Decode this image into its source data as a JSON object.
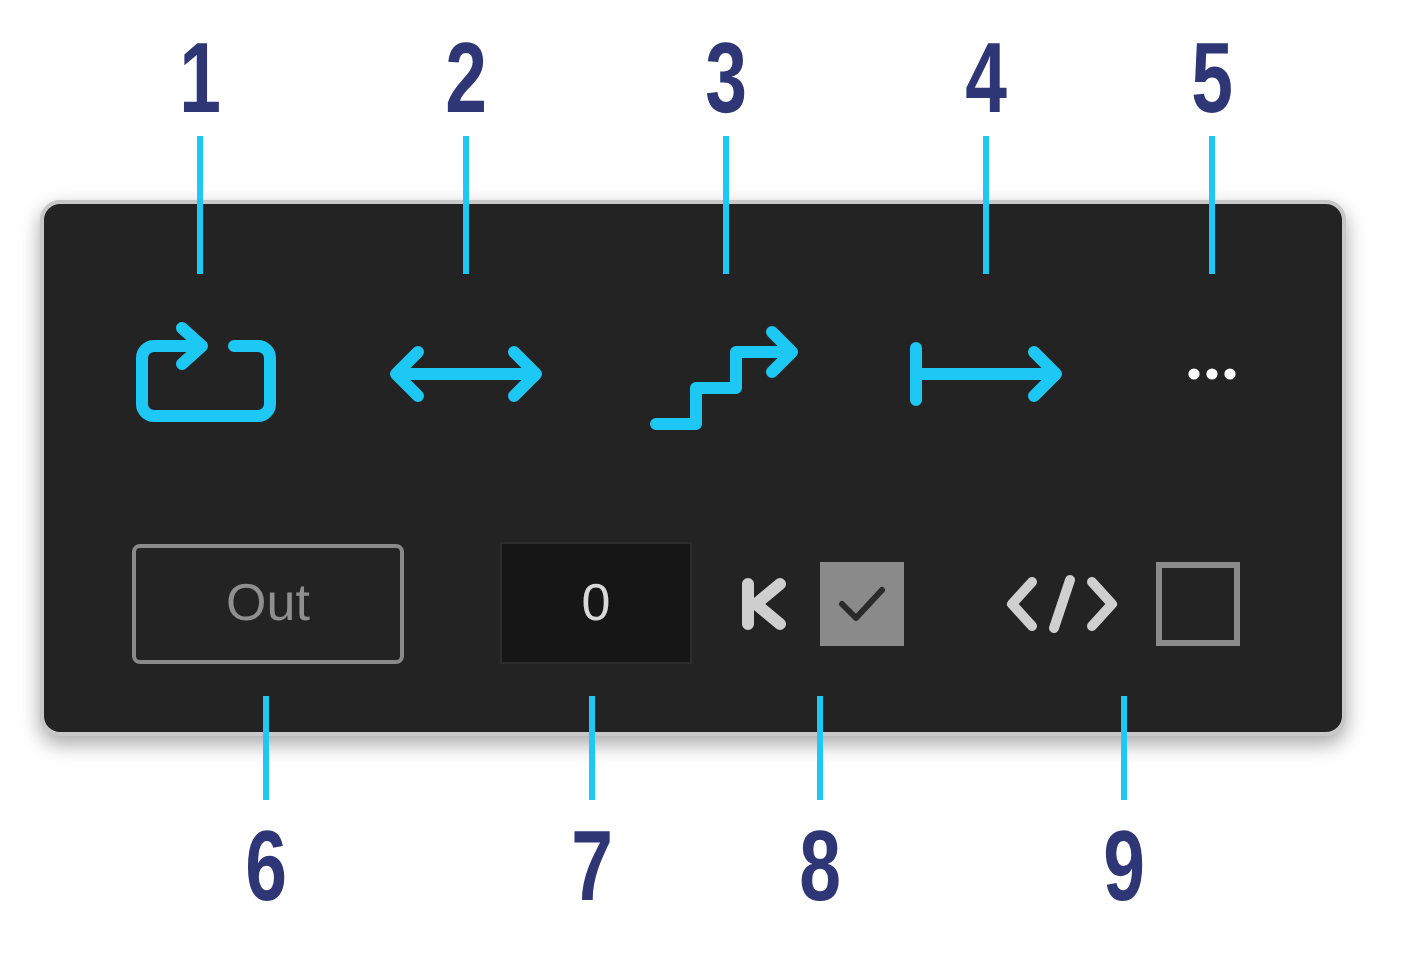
{
  "callouts_top": [
    {
      "number": "1"
    },
    {
      "number": "2"
    },
    {
      "number": "3"
    },
    {
      "number": "4"
    },
    {
      "number": "5"
    }
  ],
  "callouts_bottom": [
    {
      "number": "6"
    },
    {
      "number": "7"
    },
    {
      "number": "8"
    },
    {
      "number": "9"
    }
  ],
  "toolbar": [
    {
      "kind": "loop"
    },
    {
      "kind": "pingpong"
    },
    {
      "kind": "steps"
    },
    {
      "kind": "end"
    },
    {
      "kind": "more"
    }
  ],
  "out_button": {
    "label": "Out"
  },
  "value_field": {
    "value": "0"
  },
  "keyframe_checkbox": {
    "checked": true
  },
  "code_checkbox": {
    "checked": false
  }
}
